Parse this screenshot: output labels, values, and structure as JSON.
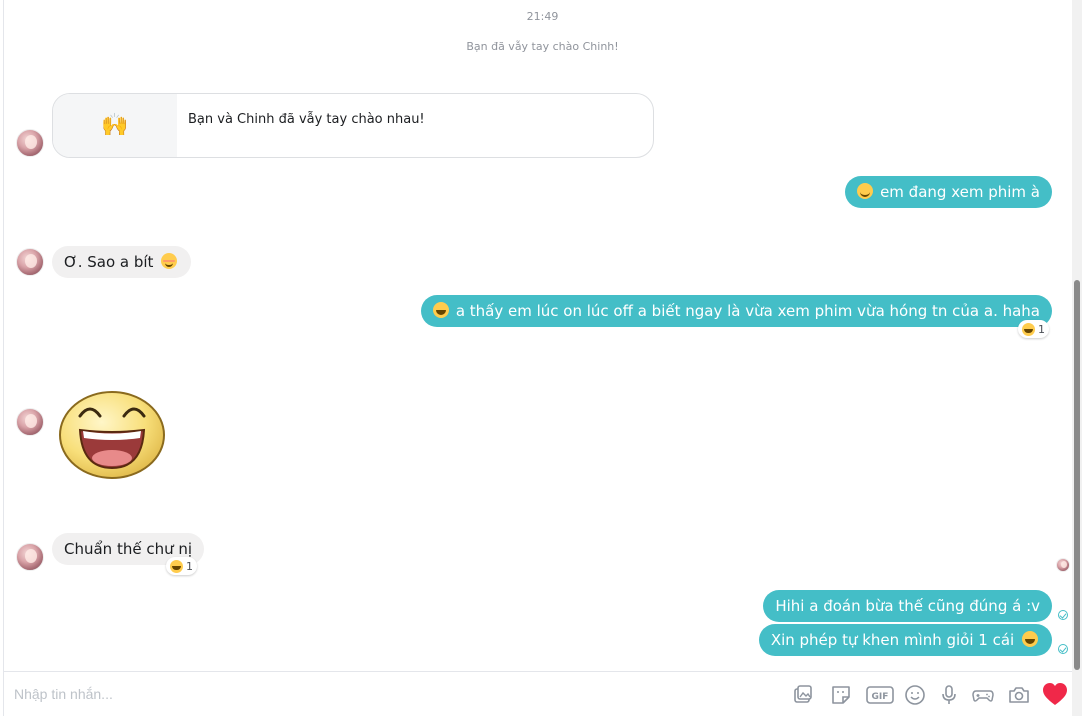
{
  "conversation": {
    "timestamp": "21:49",
    "system_message": "Bạn đã vẫy tay chào Chinh!",
    "wave_card": {
      "emoji": "🙌",
      "text": "Bạn và Chinh đã vẫy tay chào nhau!"
    },
    "messages": [
      {
        "from": "me",
        "emoji": "smile",
        "text": "em đang xem phim à"
      },
      {
        "from": "them",
        "text": "Ơ. Sao a bít",
        "emoji_after": "blush"
      },
      {
        "from": "me",
        "emoji": "grin",
        "text": "a thấy em lúc on lúc off a biết ngay là vừa xem phim vừa hóng tn của a. haha",
        "reaction_count": "1"
      },
      {
        "from": "them",
        "sticker": "laughing-face-sticker"
      },
      {
        "from": "them",
        "text": "Chuẩn thế  chư nị",
        "reaction_count": "1"
      },
      {
        "from": "me",
        "text": "Hihi a đoán bừa thế cũng đúng á :v",
        "status": "seen"
      },
      {
        "from": "me",
        "text": "Xin phép tự khen mình giỏi 1 cái",
        "emoji_after": "grin",
        "status": "seen"
      }
    ]
  },
  "composer": {
    "placeholder": "Nhập tin nhắn...",
    "tools": [
      "image-icon",
      "sticker-icon",
      "gif-icon",
      "emoji-icon",
      "microphone-icon",
      "game-controller-icon",
      "camera-icon",
      "heart-icon"
    ],
    "gif_label": "GIF"
  },
  "colors": {
    "outgoing_bubble": "#44bec7",
    "incoming_bubble": "#f1f0f0",
    "like_heart": "#f02849"
  }
}
